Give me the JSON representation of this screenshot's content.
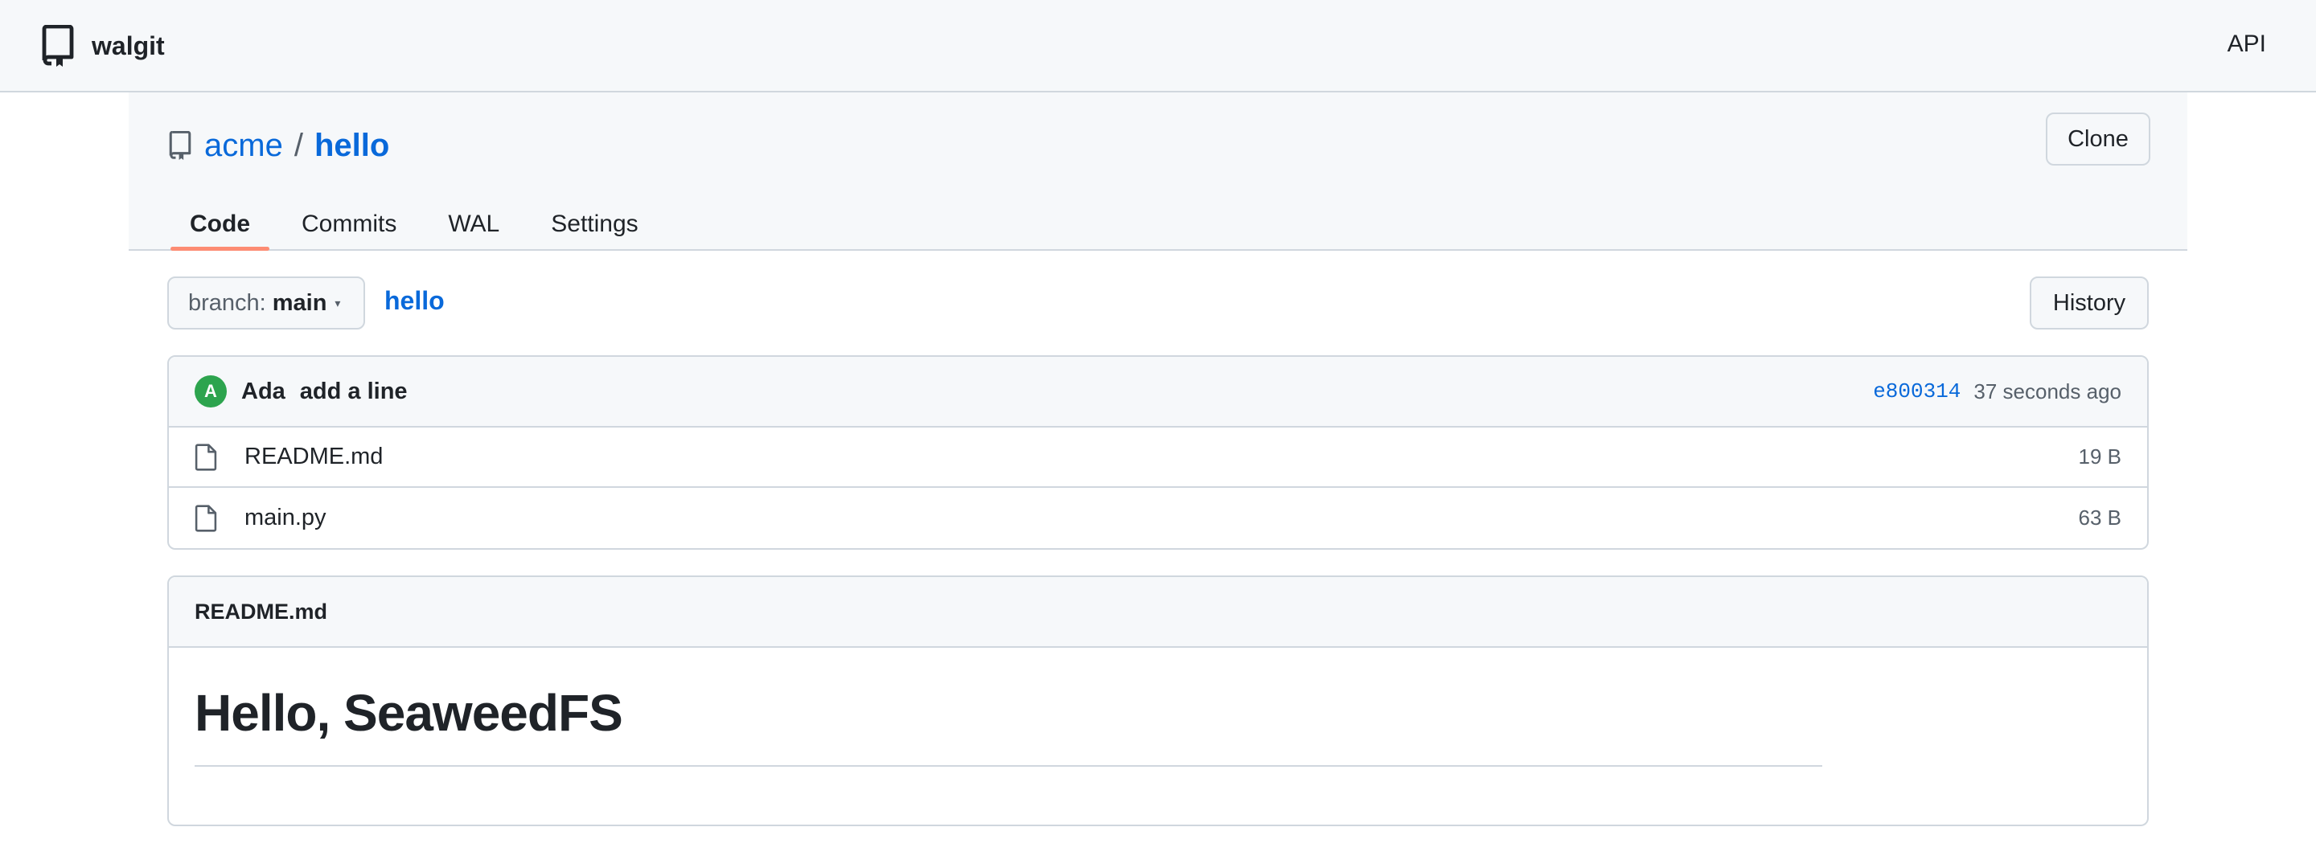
{
  "app": {
    "name": "walgit",
    "api_label": "API"
  },
  "repo": {
    "owner": "acme",
    "separator": "/",
    "name": "hello",
    "clone_label": "Clone"
  },
  "tabs": [
    {
      "label": "Code",
      "active": true
    },
    {
      "label": "Commits",
      "active": false
    },
    {
      "label": "WAL",
      "active": false
    },
    {
      "label": "Settings",
      "active": false
    }
  ],
  "toolbar": {
    "branch_prefix": "branch:",
    "branch_name": "main",
    "caret": "▾",
    "path": "hello",
    "history_label": "History"
  },
  "last_commit": {
    "avatar_initial": "A",
    "author": "Ada",
    "message": "add a line",
    "sha": "e800314",
    "time": "37 seconds ago"
  },
  "files": [
    {
      "name": "README.md",
      "size": "19 B",
      "icon": "file-icon"
    },
    {
      "name": "main.py",
      "size": "63 B",
      "icon": "file-icon"
    }
  ],
  "readme": {
    "filename": "README.md",
    "heading": "Hello, SeaweedFS"
  },
  "colors": {
    "link": "#0969da",
    "active_tab_underline": "#fd8c73",
    "avatar": "#2da44e",
    "border": "#d0d7de",
    "header_bg": "#f6f8fa"
  }
}
